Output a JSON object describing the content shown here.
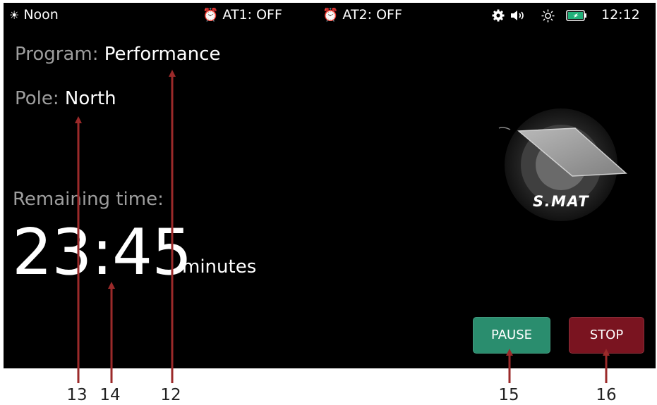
{
  "status_bar": {
    "period_icon": "sun-icon",
    "period": "Noon",
    "alarm1_icon": "alarm-clock-icon",
    "alarm1": "AT1: OFF",
    "alarm2_icon": "alarm-clock-icon",
    "alarm2": "AT2: OFF",
    "icons": [
      "gear-icon",
      "speaker-icon",
      "brightness-icon",
      "battery-icon"
    ],
    "time": "12:12"
  },
  "program": {
    "label": "Program:",
    "value": "Performance"
  },
  "pole": {
    "label": "Pole:",
    "value": "North"
  },
  "remaining": {
    "label": "Remaining time:",
    "time": "23:45",
    "unit": "minutes"
  },
  "buttons": {
    "pause": "PAUSE",
    "stop": "STOP"
  },
  "logo": {
    "text": "S.MAT"
  },
  "callouts": [
    "13",
    "14",
    "12",
    "15",
    "16"
  ],
  "colors": {
    "background": "#000000",
    "label": "#9e9e9e",
    "value": "#ffffff",
    "pause": "#2a8d6e",
    "stop": "#7a1420",
    "callout_line": "#9b2a2a",
    "battery": "#22b07a"
  }
}
